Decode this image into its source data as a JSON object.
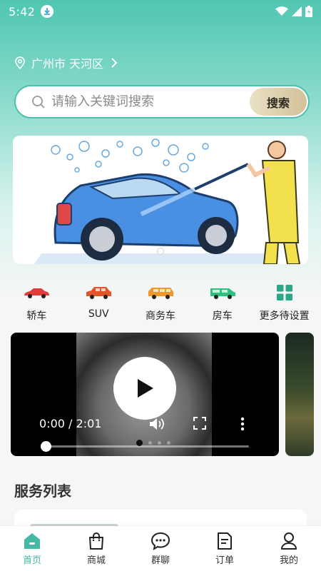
{
  "status": {
    "time": "5:42"
  },
  "location": {
    "text": "广州市 天河区"
  },
  "search": {
    "placeholder": "请输入关键词搜索",
    "button_label": "搜索"
  },
  "categories": [
    {
      "label": "轿车",
      "icon": "sedan-icon",
      "color": "#e23b3b"
    },
    {
      "label": "SUV",
      "icon": "suv-icon",
      "color": "#e2552b"
    },
    {
      "label": "商务车",
      "icon": "mpv-icon",
      "color": "#f0972c"
    },
    {
      "label": "房车",
      "icon": "rv-icon",
      "color": "#2fbf7f"
    },
    {
      "label": "更多待设置",
      "icon": "grid-icon",
      "color": "#2aa786"
    }
  ],
  "video": {
    "time": "0:00 / 2:01",
    "progress": 0
  },
  "section": {
    "title": "服务列表"
  },
  "tabs": [
    {
      "label": "首页",
      "icon": "home-icon",
      "active": true
    },
    {
      "label": "商城",
      "icon": "shopping-bag-icon",
      "active": false
    },
    {
      "label": "群聊",
      "icon": "chat-icon",
      "active": false
    },
    {
      "label": "订单",
      "icon": "order-icon",
      "active": false
    },
    {
      "label": "我的",
      "icon": "user-icon",
      "active": false
    }
  ],
  "colors": {
    "accent": "#46b9a4",
    "search_button": "#d9cba7"
  }
}
